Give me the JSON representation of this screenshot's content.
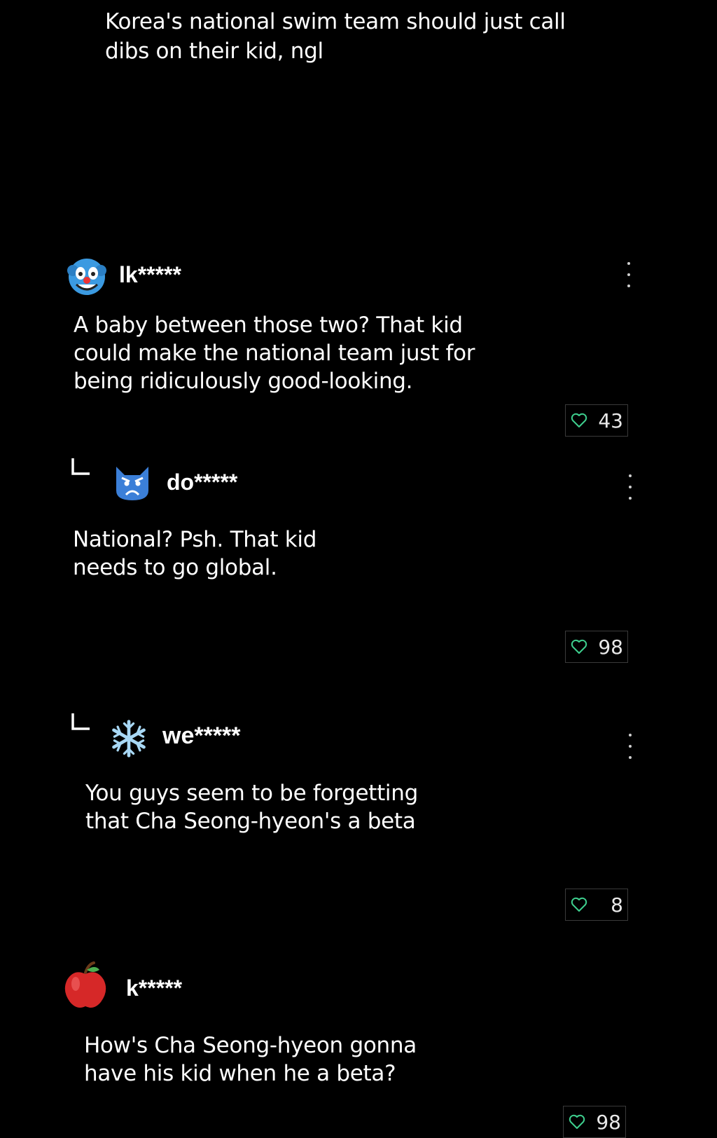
{
  "top_comment": {
    "text": "Korea's national swim team should just call\ndibs on their kid, ngl"
  },
  "comments": [
    {
      "username": "lk*****",
      "avatar_icon": "clown-face-icon",
      "text": "A baby between those two? That kid\ncould make the national team just for\nbeing ridiculously good-looking.",
      "likes": "43",
      "is_reply": false
    },
    {
      "username": "do*****",
      "avatar_icon": "angry-cat-icon",
      "text": "National? Psh. That kid\nneeds to go global.",
      "likes": "98",
      "is_reply": true
    },
    {
      "username": "we*****",
      "avatar_icon": "snowflake-icon",
      "text": "You guys seem to be forgetting\nthat Cha Seong-hyeon's a beta",
      "likes": "8",
      "is_reply": true
    },
    {
      "username": "k*****",
      "avatar_icon": "apple-icon",
      "text": "How's Cha Seong-hyeon gonna\nhave his kid when he a beta?",
      "likes": "98",
      "is_reply": false
    }
  ],
  "colors": {
    "background": "#000000",
    "heart_accent": "#3ecf8e",
    "like_border": "#3a3a3a"
  }
}
